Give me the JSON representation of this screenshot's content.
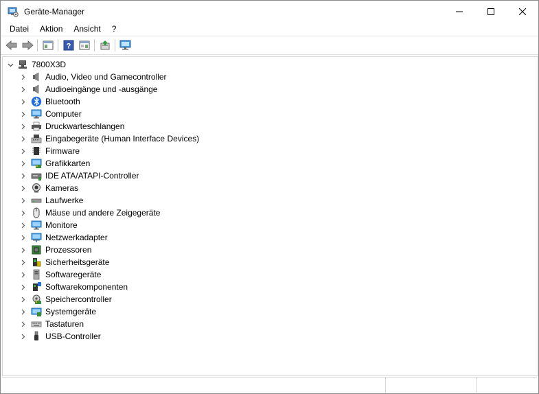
{
  "window": {
    "title": "Geräte-Manager"
  },
  "menu": [
    {
      "label": "Datei"
    },
    {
      "label": "Aktion"
    },
    {
      "label": "Ansicht"
    },
    {
      "label": "?"
    }
  ],
  "tree": {
    "root": {
      "label": "7800X3D",
      "icon": "computer-icon"
    },
    "items": [
      {
        "label": "Audio, Video und Gamecontroller",
        "icon": "speaker-icon"
      },
      {
        "label": "Audioeingänge und -ausgänge",
        "icon": "speaker-icon"
      },
      {
        "label": "Bluetooth",
        "icon": "bluetooth-icon"
      },
      {
        "label": "Computer",
        "icon": "monitor-icon"
      },
      {
        "label": "Druckwarteschlangen",
        "icon": "printer-icon"
      },
      {
        "label": "Eingabegeräte (Human Interface Devices)",
        "icon": "hid-icon"
      },
      {
        "label": "Firmware",
        "icon": "chip-icon"
      },
      {
        "label": "Grafikkarten",
        "icon": "display-adapter-icon"
      },
      {
        "label": "IDE ATA/ATAPI-Controller",
        "icon": "ide-controller-icon"
      },
      {
        "label": "Kameras",
        "icon": "camera-icon"
      },
      {
        "label": "Laufwerke",
        "icon": "drive-icon"
      },
      {
        "label": "Mäuse und andere Zeigegeräte",
        "icon": "mouse-icon"
      },
      {
        "label": "Monitore",
        "icon": "monitor-icon"
      },
      {
        "label": "Netzwerkadapter",
        "icon": "network-icon"
      },
      {
        "label": "Prozessoren",
        "icon": "processor-icon"
      },
      {
        "label": "Sicherheitsgeräte",
        "icon": "security-device-icon"
      },
      {
        "label": "Softwaregeräte",
        "icon": "software-device-icon"
      },
      {
        "label": "Softwarekomponenten",
        "icon": "software-component-icon"
      },
      {
        "label": "Speichercontroller",
        "icon": "storage-controller-icon"
      },
      {
        "label": "Systemgeräte",
        "icon": "system-device-icon"
      },
      {
        "label": "Tastaturen",
        "icon": "keyboard-icon"
      },
      {
        "label": "USB-Controller",
        "icon": "usb-icon"
      }
    ]
  },
  "colors": {
    "accent": "#1e88e5",
    "chevron": "#555555"
  }
}
